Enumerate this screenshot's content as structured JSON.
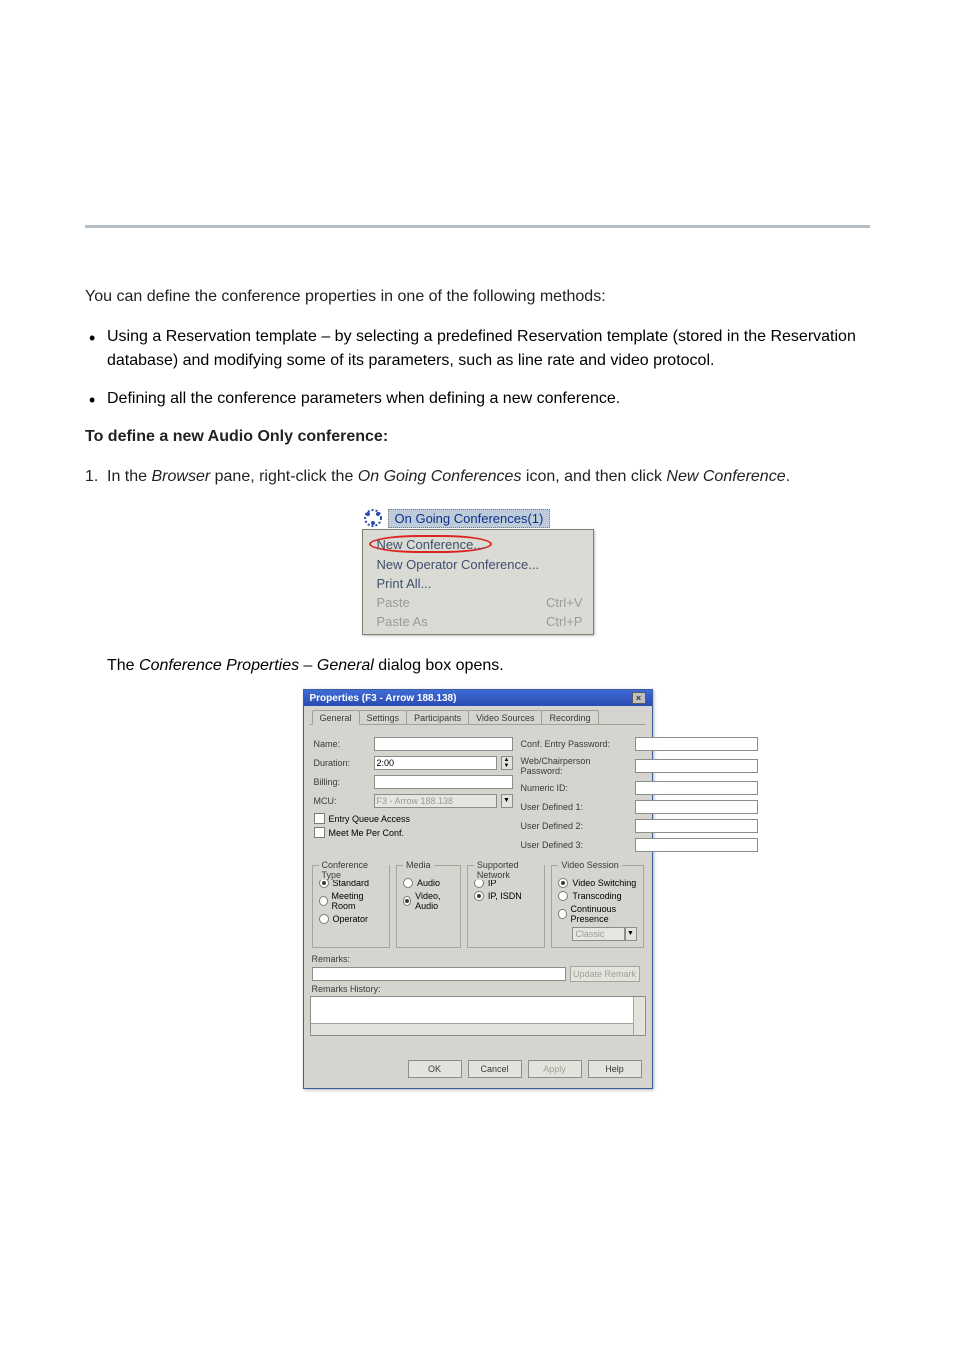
{
  "intro": [
    "You can define the conference properties in one of the following methods:",
    "Using a Reservation template – by selecting a predefined Reservation template (stored in the Reservation database) and modifying some of its parameters, such as line rate and video protocol.",
    "Defining all the conference parameters when defining a new conference."
  ],
  "proc_intro": "To define a new Audio Only conference:",
  "step1": {
    "num": "1.",
    "text_a": "In the ",
    "em1": "Browser",
    "text_b": " pane, right-click the ",
    "em2": "On Going Conferences",
    "text_c": " icon, and then click ",
    "strong": "New Conference",
    "text_d": "."
  },
  "context_menu": {
    "title": "On Going Conferences(1)",
    "items": [
      {
        "label": "New Conference...",
        "circled": true
      },
      {
        "label": "New Operator Conference..."
      },
      {
        "label": "Print All..."
      },
      {
        "label": "Paste",
        "shortcut": "Ctrl+V",
        "disabled": true
      },
      {
        "label": "Paste As",
        "shortcut": "Ctrl+P",
        "disabled": true
      }
    ]
  },
  "step2": {
    "prefix": "The ",
    "em": "Conference Properties – General",
    "suffix": " dialog box opens."
  },
  "dialog": {
    "title": "Properties (F3 - Arrow 188.138)",
    "close": "×",
    "tabs": [
      "General",
      "Settings",
      "Participants",
      "Video Sources",
      "Recording"
    ],
    "active_tab": 0,
    "left_labels": {
      "name": "Name:",
      "duration": "Duration:",
      "billing": "Billing:",
      "mcu": "MCU:"
    },
    "left_values": {
      "duration": "2:00",
      "mcu": "F3 - Arrow 188.138"
    },
    "checks": {
      "eq": "Entry Queue Access",
      "mm": "Meet Me Per Conf."
    },
    "right_labels": {
      "cep": "Conf. Entry Password:",
      "wcp": "Web/Chairperson Password:",
      "nid": "Numeric ID:",
      "ud1": "User Defined 1:",
      "ud2": "User Defined 2:",
      "ud3": "User Defined 3:"
    },
    "groups": {
      "conf_type": {
        "legend": "Conference Type",
        "opts": [
          "Standard",
          "Meeting Room",
          "Operator"
        ],
        "sel": 0
      },
      "media": {
        "legend": "Media",
        "opts": [
          "Audio",
          "Video, Audio"
        ],
        "sel": 1
      },
      "network": {
        "legend": "Supported Network",
        "opts": [
          "IP",
          "IP, ISDN"
        ],
        "sel": 1
      },
      "video": {
        "legend": "Video Session",
        "opts": [
          "Video Switching",
          "Transcoding",
          "Continuous Presence"
        ],
        "sel": 0,
        "dd": "Classic"
      }
    },
    "remarks_label": "Remarks:",
    "update_remark": "Update Remark",
    "history_label": "Remarks History:",
    "buttons": {
      "ok": "OK",
      "cancel": "Cancel",
      "apply": "Apply",
      "help": "Help"
    }
  }
}
